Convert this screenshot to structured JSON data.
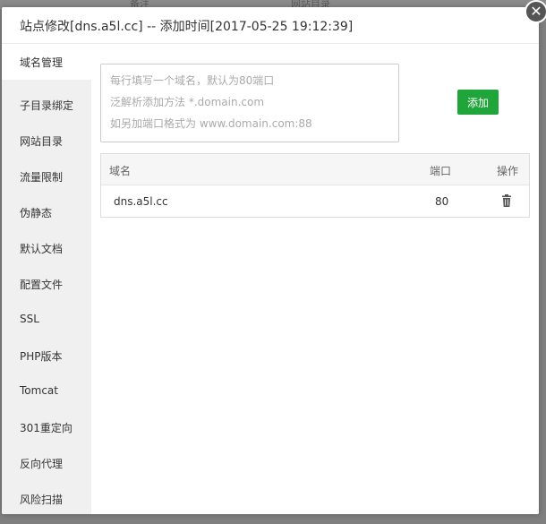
{
  "background": {
    "col1": "备注",
    "col2": "网站目录"
  },
  "modal": {
    "title": "站点修改[dns.a5l.cc] -- 添加时间[2017-05-25 19:12:39]",
    "close_glyph": "✕"
  },
  "sidebar": {
    "items": [
      {
        "label": "域名管理",
        "active": true
      },
      {
        "label": "子目录绑定"
      },
      {
        "label": "网站目录"
      },
      {
        "label": "流量限制"
      },
      {
        "label": "伪静态"
      },
      {
        "label": "默认文档"
      },
      {
        "label": "配置文件"
      },
      {
        "label": "SSL"
      },
      {
        "label": "PHP版本"
      },
      {
        "label": "Tomcat"
      },
      {
        "label": "301重定向"
      },
      {
        "label": "反向代理"
      },
      {
        "label": "风险扫描"
      }
    ]
  },
  "domain_form": {
    "placeholder_lines": [
      "每行填写一个域名，默认为80端口",
      "泛解析添加方法 *.domain.com",
      "如另加端口格式为 www.domain.com:88"
    ],
    "add_label": "添加"
  },
  "table": {
    "headers": {
      "domain": "域名",
      "port": "端口",
      "action": "操作"
    },
    "rows": [
      {
        "domain": "dns.a5l.cc",
        "port": "80"
      }
    ]
  },
  "colors": {
    "accent": "#20a53a",
    "sidebar_bg": "#f0f0f0",
    "overlay": "#7f7f7f"
  },
  "icons": {
    "delete": "trash-icon",
    "close": "close-icon"
  }
}
